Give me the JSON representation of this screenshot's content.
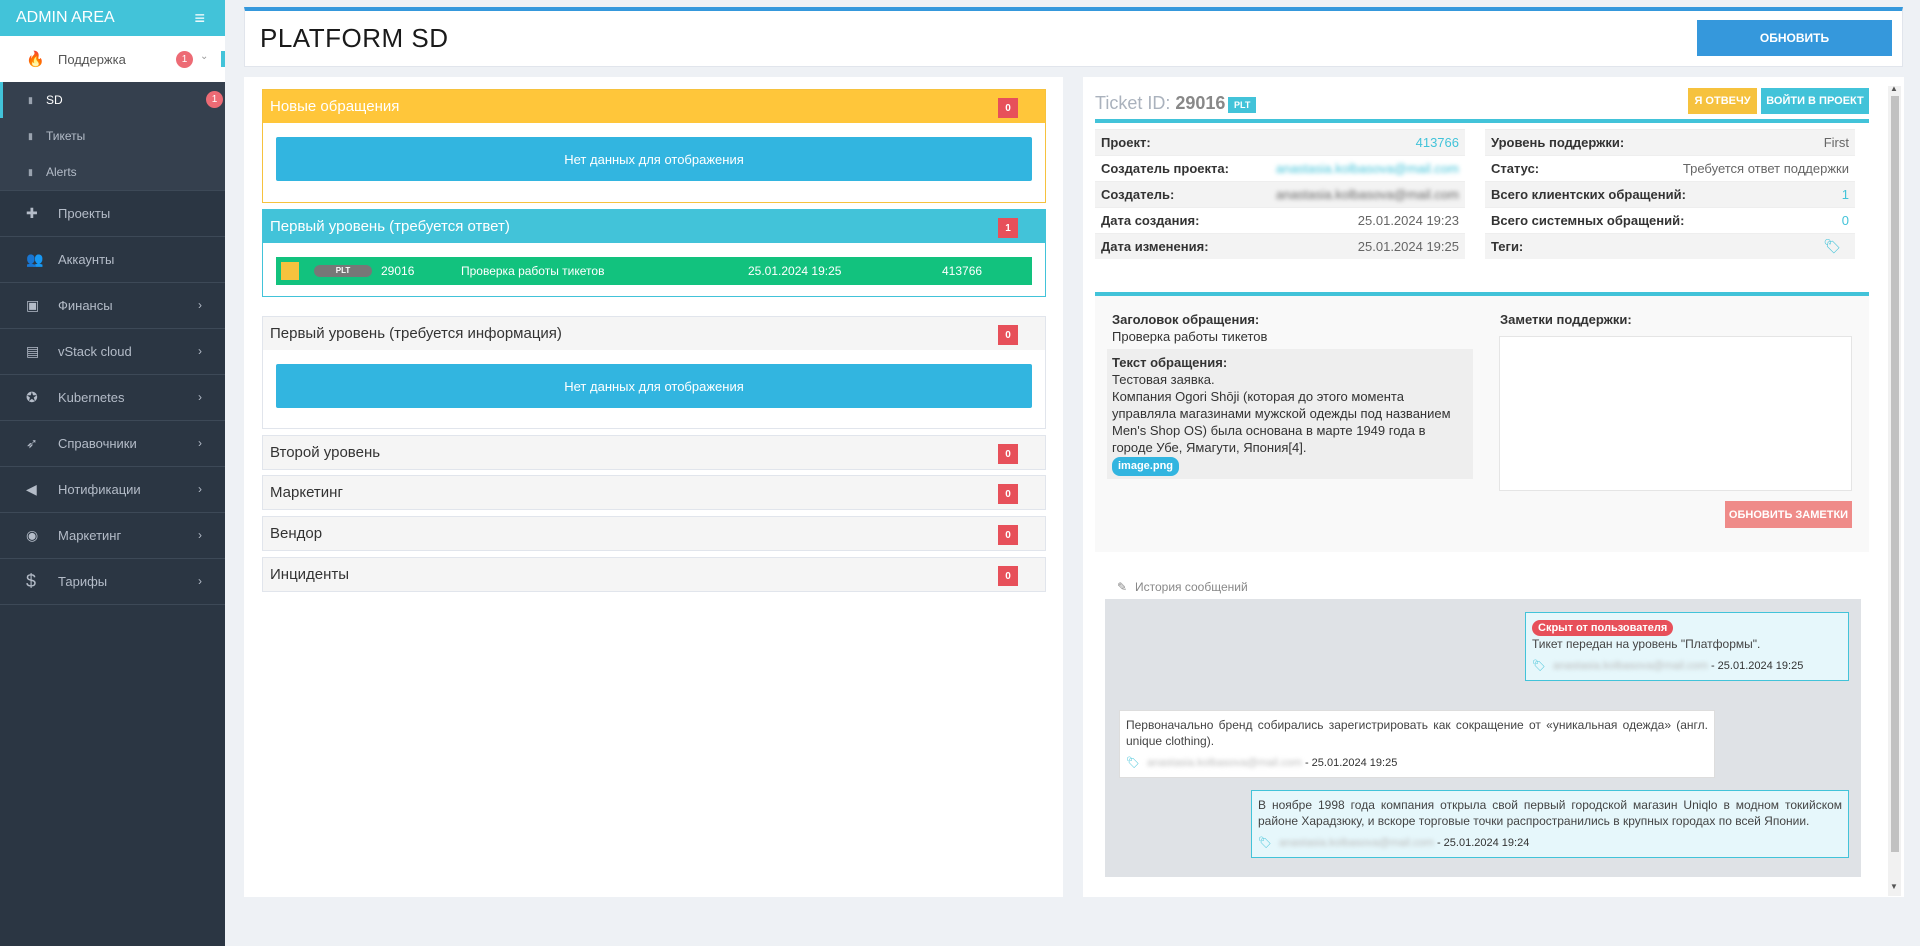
{
  "sidebar": {
    "brand": "ADMIN AREA",
    "support": {
      "label": "Поддержка",
      "badge": "1"
    },
    "sub_items": [
      {
        "label": "SD",
        "badge": "1"
      },
      {
        "label": "Тикеты"
      },
      {
        "label": "Alerts"
      }
    ],
    "items": [
      {
        "label": "Проекты",
        "icon": "puzzle-icon",
        "glyph": "✚"
      },
      {
        "label": "Аккаунты",
        "icon": "users-icon",
        "glyph": "👥"
      },
      {
        "label": "Финансы",
        "icon": "money-icon",
        "glyph": "▣"
      },
      {
        "label": "vStack cloud",
        "icon": "terminal-icon",
        "glyph": "▤"
      },
      {
        "label": "Kubernetes",
        "icon": "helm-icon",
        "glyph": "✪"
      },
      {
        "label": "Справочники",
        "icon": "rocket-icon",
        "glyph": "➶"
      },
      {
        "label": "Нотификации",
        "icon": "megaphone-icon",
        "glyph": "◀"
      },
      {
        "label": "Маркетинг",
        "icon": "piggy-bank-icon",
        "glyph": "◉"
      },
      {
        "label": "Тарифы",
        "icon": "dollar-icon",
        "glyph": "$"
      }
    ]
  },
  "header": {
    "title": "PLATFORM SD",
    "refresh": "ОБНОВИТЬ"
  },
  "groups": {
    "new": {
      "title": "Новые обращения",
      "count": "0",
      "empty": "Нет данных для отображения"
    },
    "first_answer": {
      "title": "Первый уровень (требуется ответ)",
      "count": "1",
      "row": {
        "plt": "PLT",
        "id": "29016",
        "subject": "Проверка работы тикетов",
        "date": "25.01.2024 19:25",
        "project": "413766"
      }
    },
    "first_info": {
      "title": "Первый уровень (требуется информация)",
      "count": "0",
      "empty": "Нет данных для отображения"
    },
    "second": {
      "title": "Второй уровень",
      "count": "0"
    },
    "marketing": {
      "title": "Маркетинг",
      "count": "0"
    },
    "vendor": {
      "title": "Вендор",
      "count": "0"
    },
    "incidents": {
      "title": "Инциденты",
      "count": "0"
    }
  },
  "ticket": {
    "id_label": "Ticket ID:",
    "id": "29016",
    "badge": "PLT",
    "btn_answer": "Я ОТВЕЧУ",
    "btn_login": "ВОЙТИ В ПРОЕКТ",
    "left": [
      {
        "k": "Проект:",
        "v": "413766"
      },
      {
        "k": "Создатель проекта:",
        "v": "anastasia.kolbasova@mail.com"
      },
      {
        "k": "Создатель:",
        "v": "anastasia.kolbasova@mail.com"
      },
      {
        "k": "Дата создания:",
        "v": "25.01.2024 19:23"
      },
      {
        "k": "Дата изменения:",
        "v": "25.01.2024 19:25"
      }
    ],
    "right": [
      {
        "k": "Уровень поддержки:",
        "v": "First"
      },
      {
        "k": "Статус:",
        "v": "Требуется ответ поддержки"
      },
      {
        "k": "Всего клиентских обращений:",
        "v": "1"
      },
      {
        "k": "Всего системных обращений:",
        "v": "0"
      },
      {
        "k": "Теги:",
        "v": ""
      }
    ],
    "subject_label": "Заголовок обращения:",
    "subject": "Проверка работы тикетов",
    "body_label": "Текст обращения:",
    "body_line1": "Тестовая заявка.",
    "body_text": "Компания Ogori Shōji (которая до этого момента управляла магазинами мужской одежды под названием Men's Shop OS) была основана в марте 1949 года в городе Убе, Ямагути, Япония[4].",
    "attachment": "image.png",
    "notes_label": "Заметки поддержки:",
    "notes_btn": "ОБНОВИТЬ ЗАМЕТКИ"
  },
  "history": {
    "title": "История сообщений",
    "messages": [
      {
        "hidden": "Скрыт от пользователя",
        "text": "Тикет передан на уровень \"Платформы\".",
        "author": "anastasia.kolbasova@mail.com",
        "date": "- 25.01.2024 19:25"
      },
      {
        "text": "Первоначально бренд собирались зарегистрировать как сокращение от «уникальная одежда» (англ. unique clothing).",
        "author": "anastasia.kolbasova@mail.com",
        "date": "- 25.01.2024 19:25"
      },
      {
        "text": "В ноябре 1998 года компания открыла свой первый городской магазин Uniqlo в модном токийском районе Харадзюку, и вскоре торговые точки распространились в крупных городах по всей Японии.",
        "author": "anastasia.kolbasova@mail.com",
        "date": "- 25.01.2024 19:24"
      }
    ]
  }
}
